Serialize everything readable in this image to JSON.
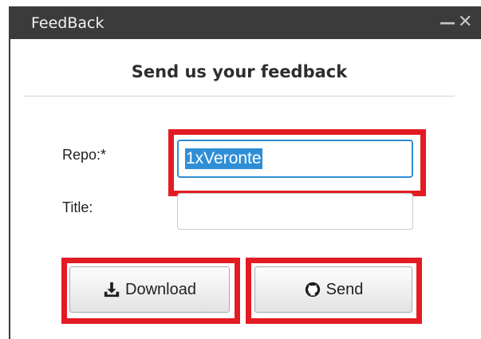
{
  "window": {
    "title": "FeedBack",
    "minimize_glyph": "—",
    "close_glyph": "✕"
  },
  "form": {
    "heading": "Send us your feedback",
    "repo_label": "Repo:*",
    "repo_value": "1xVeronte",
    "title_label": "Title:",
    "title_value": ""
  },
  "buttons": {
    "download_label": "Download",
    "download_icon": "download-tray-icon",
    "send_label": "Send",
    "send_icon": "github-icon"
  },
  "colors": {
    "titlebar": "#3b3b3b",
    "highlight": "#e31b23",
    "selection": "#2f8ed6"
  }
}
